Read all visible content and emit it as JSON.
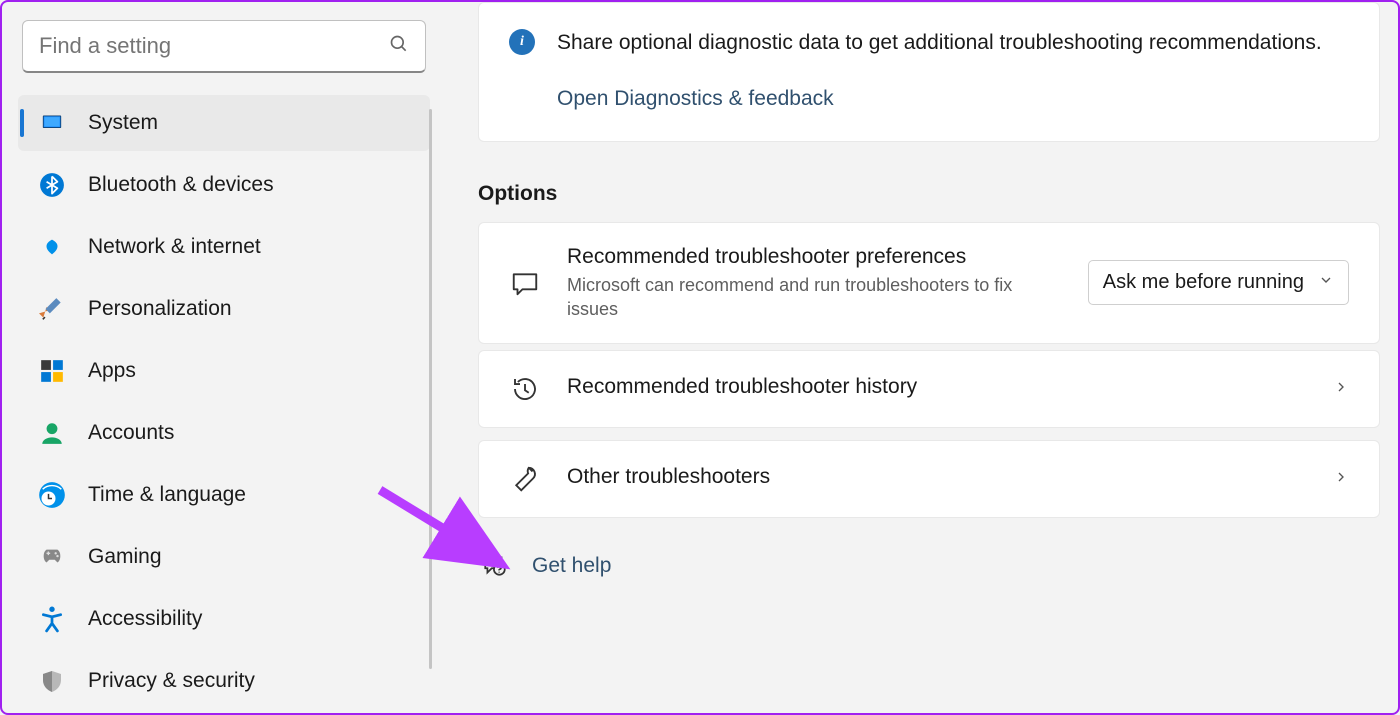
{
  "search": {
    "placeholder": "Find a setting"
  },
  "sidebar": {
    "items": [
      {
        "icon": "system",
        "label": "System",
        "active": true
      },
      {
        "icon": "bluetooth",
        "label": "Bluetooth & devices",
        "active": false
      },
      {
        "icon": "network",
        "label": "Network & internet",
        "active": false
      },
      {
        "icon": "personalization",
        "label": "Personalization",
        "active": false
      },
      {
        "icon": "apps",
        "label": "Apps",
        "active": false
      },
      {
        "icon": "accounts",
        "label": "Accounts",
        "active": false
      },
      {
        "icon": "time",
        "label": "Time & language",
        "active": false
      },
      {
        "icon": "gaming",
        "label": "Gaming",
        "active": false
      },
      {
        "icon": "accessibility",
        "label": "Accessibility",
        "active": false
      },
      {
        "icon": "privacy",
        "label": "Privacy & security",
        "active": false
      }
    ]
  },
  "info": {
    "text": "Share optional diagnostic data to get additional troubleshooting recommendations.",
    "link": "Open Diagnostics & feedback"
  },
  "options_title": "Options",
  "pref": {
    "title": "Recommended troubleshooter preferences",
    "subtitle": "Microsoft can recommend and run troubleshooters to fix issues",
    "selected": "Ask me before running"
  },
  "history": {
    "title": "Recommended troubleshooter history"
  },
  "other": {
    "title": "Other troubleshooters"
  },
  "help": {
    "label": "Get help"
  }
}
